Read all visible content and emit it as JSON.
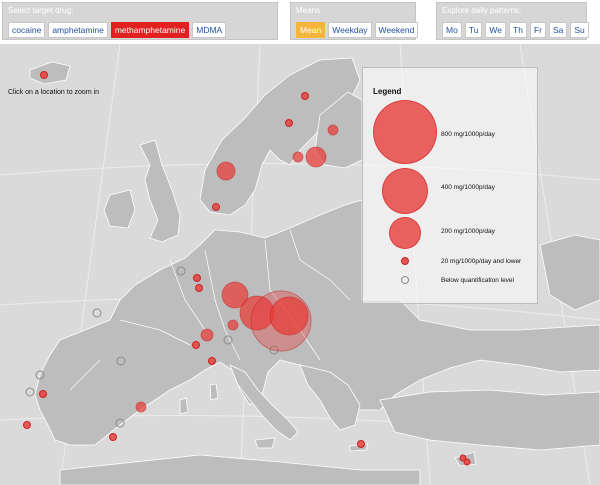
{
  "drug_panel": {
    "title": "Select target drug:",
    "buttons": [
      "cocaine",
      "amphetamine",
      "methamphetamine",
      "MDMA"
    ],
    "selected": "methamphetamine"
  },
  "means_panel": {
    "title": "Means",
    "buttons": [
      "Mean",
      "Weekday",
      "Weekend"
    ],
    "selected": "Mean"
  },
  "patterns_panel": {
    "title": "Explore daily patterns:",
    "buttons": [
      "Mo",
      "Tu",
      "We",
      "Th",
      "Fr",
      "Sa",
      "Su"
    ]
  },
  "map": {
    "hint": "Click on a location to zoom in"
  },
  "legend": {
    "title": "Legend",
    "items": [
      "800 mg/1000p/day",
      "400 mg/1000p/day",
      "200 mg/1000p/day",
      "20 mg/1000p/day and lower",
      "Below quantification level"
    ]
  },
  "colors": {
    "accent_red": "#e1211f",
    "accent_yellow": "#f4b53a",
    "link_blue": "#1f4f9e",
    "land": "#bdbdbd",
    "sea": "#d9d9d9"
  }
}
